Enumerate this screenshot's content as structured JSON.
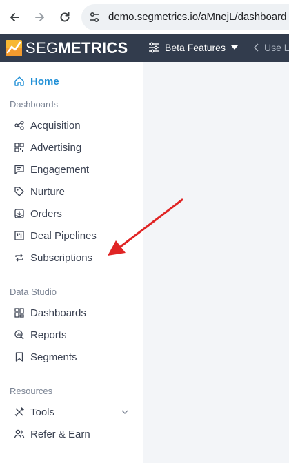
{
  "browser": {
    "url": "demo.segmetrics.io/aMnejL/dashboard"
  },
  "header": {
    "logo_light": "SEG",
    "logo_bold": "METRICS",
    "beta_features_label": "Beta Features",
    "use_legacy_label": "Use Le"
  },
  "sidebar": {
    "home_label": "Home",
    "sections": {
      "dashboards": "Dashboards",
      "data_studio": "Data Studio",
      "resources": "Resources"
    },
    "dashboards_items": [
      "Acquisition",
      "Advertising",
      "Engagement",
      "Nurture",
      "Orders",
      "Deal Pipelines",
      "Subscriptions"
    ],
    "data_studio_items": [
      "Dashboards",
      "Reports",
      "Segments"
    ],
    "resources_items": [
      "Tools",
      "Refer & Earn"
    ]
  },
  "colors": {
    "active": "#1f8fd6",
    "header_bg": "#323c4d",
    "annotation_arrow": "#e02424"
  }
}
